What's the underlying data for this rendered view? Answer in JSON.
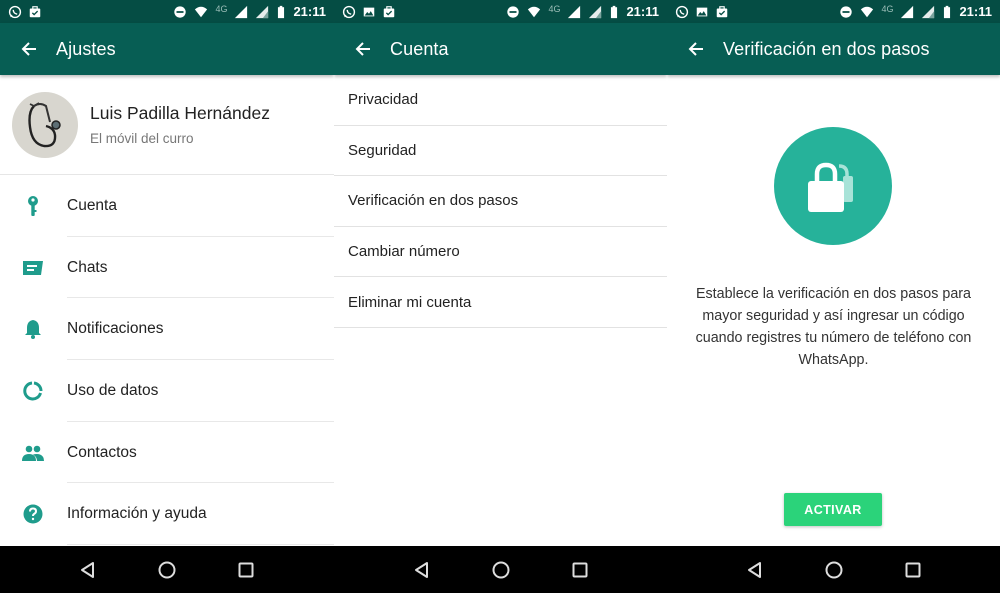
{
  "colors": {
    "toolbar": "#075e54",
    "statusbar": "#054d44",
    "accent_icon": "#1f9c8c",
    "lock_circle": "#26b29a",
    "activate_button": "#2bd37a"
  },
  "status_bar": {
    "time": "21:11",
    "network_label": "4G",
    "icons_left": [
      "whatsapp-icon",
      "gallery-icon",
      "briefcase-check-icon"
    ],
    "icons_right": [
      "do-not-disturb-icon",
      "wifi-icon",
      "signal-icon",
      "signal-icon",
      "battery-icon"
    ]
  },
  "screens": [
    {
      "toolbar": {
        "back_icon": "arrow-left-icon",
        "title": "Ajustes"
      },
      "profile": {
        "name": "Luis Padilla Hernández",
        "status": "El móvil del curro",
        "avatar": "stethoscope-photo"
      },
      "menu": [
        {
          "icon": "key-icon",
          "label": "Cuenta"
        },
        {
          "icon": "chat-icon",
          "label": "Chats"
        },
        {
          "icon": "bell-icon",
          "label": "Notificaciones"
        },
        {
          "icon": "data-usage-icon",
          "label": "Uso de datos"
        },
        {
          "icon": "contacts-icon",
          "label": "Contactos"
        },
        {
          "icon": "help-icon",
          "label": "Información y ayuda"
        }
      ]
    },
    {
      "toolbar": {
        "back_icon": "arrow-left-icon",
        "title": "Cuenta"
      },
      "menu": [
        {
          "label": "Privacidad"
        },
        {
          "label": "Seguridad"
        },
        {
          "label": "Verificación en dos pasos"
        },
        {
          "label": "Cambiar número"
        },
        {
          "label": "Eliminar mi cuenta"
        }
      ]
    },
    {
      "toolbar": {
        "back_icon": "arrow-left-icon",
        "title": "Verificación en dos pasos"
      },
      "illustration": "padlock-icon",
      "description": "Establece la verificación en dos pasos para mayor seguridad y así ingresar un código cuando registres tu número de teléfono con WhatsApp.",
      "button_label": "ACTIVAR"
    }
  ],
  "nav_bar": [
    "back-triangle-icon",
    "home-circle-icon",
    "recents-square-icon"
  ]
}
